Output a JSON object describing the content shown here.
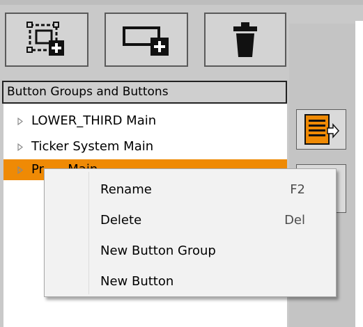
{
  "toolbar": {
    "buttons": [
      {
        "name": "new-button-group",
        "icon": "new-group-icon"
      },
      {
        "name": "new-button",
        "icon": "new-button-icon"
      },
      {
        "name": "delete",
        "icon": "trash-icon"
      }
    ]
  },
  "tree": {
    "header": "Button Groups and Buttons",
    "items": [
      {
        "label": "LOWER_THIRD Main",
        "selected": false
      },
      {
        "label": "Ticker System Main",
        "selected": false
      },
      {
        "label": "Pr      Main",
        "selected": true
      }
    ]
  },
  "context_menu": {
    "items": [
      {
        "label": "Rename",
        "shortcut": "F2"
      },
      {
        "label": "Delete",
        "shortcut": "Del"
      },
      {
        "label": "New Button Group",
        "shortcut": ""
      },
      {
        "label": "New Button",
        "shortcut": ""
      }
    ]
  },
  "colors": {
    "selection": "#ef8a05",
    "accent_icon": "#ef8a05"
  }
}
